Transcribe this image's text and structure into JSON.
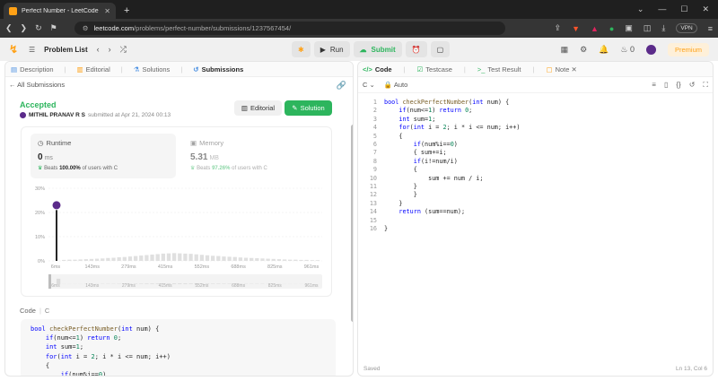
{
  "browser": {
    "tab_title": "Perfect Number - LeetCode",
    "url_host": "leetcode.com",
    "url_path": "/problems/perfect-number/submissions/1237567454/",
    "vpn_label": "VPN"
  },
  "nav": {
    "problem_list": "Problem List",
    "run": "Run",
    "submit": "Submit",
    "streak": "0",
    "premium": "Premium"
  },
  "left_tabs": [
    "Description",
    "Editorial",
    "Solutions",
    "Submissions"
  ],
  "submission": {
    "back": "All Submissions",
    "status": "Accepted",
    "user": "MITHIL PRANAV R S",
    "submitted_at": "submitted at Apr 21, 2024 00:13",
    "editorial_btn": "Editorial",
    "solution_btn": "Solution"
  },
  "runtime": {
    "label": "Runtime",
    "value": "0",
    "unit": "ms",
    "beats_label": "Beats",
    "beats_pct": "100.00%",
    "beats_suffix": "of users with C"
  },
  "memory": {
    "label": "Memory",
    "value": "5.31",
    "unit": "MB",
    "beats_label": "Beats",
    "beats_pct": "97.26%",
    "beats_suffix": "of users with C"
  },
  "chart_data": {
    "type": "bar",
    "title": "",
    "xlabel": "",
    "ylabel": "",
    "ytick_labels": [
      "0%",
      "10%",
      "20%",
      "30%"
    ],
    "ylim": [
      0,
      30
    ],
    "xtick_labels": [
      "6ms",
      "143ms",
      "279ms",
      "415ms",
      "552ms",
      "688ms",
      "825ms",
      "961ms"
    ],
    "values": [
      23,
      0.4,
      0.5,
      0.5,
      0.6,
      0.7,
      0.8,
      0.9,
      1.0,
      1.2,
      1.3,
      1.5,
      1.6,
      1.8,
      2.0,
      2.2,
      2.4,
      2.6,
      2.8,
      3.0,
      3.1,
      3.2,
      3.1,
      3.0,
      2.9,
      2.7,
      2.5,
      2.3,
      2.1,
      2.0,
      1.8,
      1.7,
      1.6,
      1.4,
      1.3,
      1.2,
      1.1,
      1.0,
      0.9,
      0.8,
      0.7,
      0.6,
      0.5,
      0.5,
      0.4,
      0.4,
      0.3,
      0.3
    ],
    "highlight_index": 0,
    "grid": true
  },
  "code_section": {
    "label": "Code",
    "lang": "C",
    "snippet": [
      "bool checkPerfectNumber(int num) {",
      "    if(num<=1) return 0;",
      "    int sum=1;",
      "    for(int i = 2; i * i <= num; i++)",
      "    {",
      "        if(num%i==0)"
    ]
  },
  "right_tabs": [
    "Code",
    "Testcase",
    "Test Result",
    "Note"
  ],
  "editor": {
    "language": "C",
    "mode": "Auto",
    "lines": [
      "bool checkPerfectNumber(int num) {",
      "    if(num<=1) return 0;",
      "    int sum=1;",
      "    for(int i = 2; i * i <= num; i++)",
      "    {",
      "        if(num%i==0)",
      "        { sum+=i;",
      "        if(i!=num/i)",
      "        {",
      "            sum += num / i;",
      "        }",
      "        }",
      "    }",
      "    return (sum==num);",
      "",
      "}"
    ],
    "status": "Saved",
    "cursor": "Ln 13, Col 6"
  }
}
